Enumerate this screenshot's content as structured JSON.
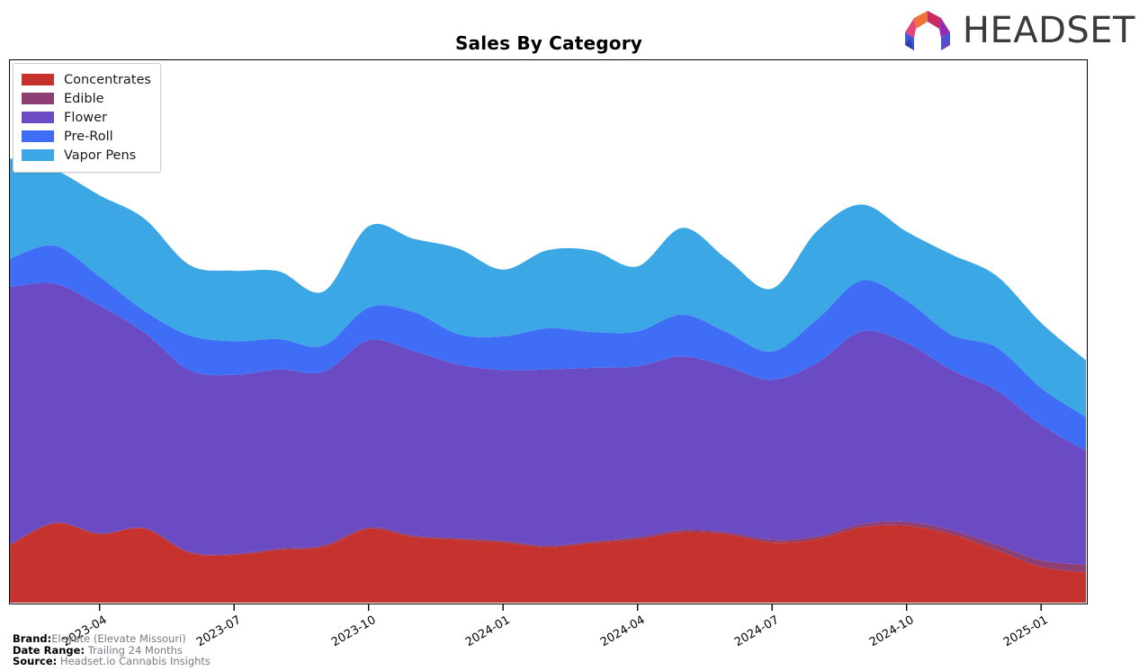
{
  "header": {
    "title": "Sales By Category",
    "logo_text": "HEADSET",
    "logo_icon": "headset-arch-logo"
  },
  "footer": {
    "rows": [
      {
        "key": "Brand:",
        "value": "Elevate (Elevate Missouri)"
      },
      {
        "key": "Date Range:",
        "value": "Trailing 24 Months"
      },
      {
        "key": "Source:",
        "value": "Headset.io Cannabis Insights"
      }
    ]
  },
  "chart_data": {
    "type": "area",
    "stacked": true,
    "title": "Sales By Category",
    "xlabel": "",
    "ylabel": "",
    "grid": false,
    "legend_position": "top-left",
    "x_tick_labels": [
      "2023-04",
      "2023-07",
      "2023-10",
      "2024-01",
      "2024-04",
      "2024-07",
      "2024-10",
      "2025-01"
    ],
    "x_tick_values": [
      3,
      6,
      9,
      12,
      15,
      18,
      21,
      24
    ],
    "x_range": [
      1,
      25
    ],
    "y_range": [
      0,
      100
    ],
    "x": [
      1,
      2,
      3,
      4,
      5,
      6,
      7,
      8,
      9,
      10,
      11,
      12,
      13,
      14,
      15,
      16,
      17,
      18,
      19,
      20,
      21,
      22,
      23,
      24,
      25
    ],
    "colors": {
      "Concentrates": "#c6332f",
      "Edible": "#8e3f73",
      "Flower": "#6b4bc4",
      "Pre-Roll": "#3f6df5",
      "Vapor Pens": "#3ba7e4"
    },
    "series": [
      {
        "name": "Concentrates",
        "color": "#c6332f",
        "values": [
          10.5,
          14.6,
          12.6,
          13.6,
          9.2,
          8.8,
          9.7,
          10.3,
          13.6,
          12.1,
          11.6,
          11.1,
          10.2,
          11.0,
          11.7,
          13.0,
          12.6,
          11.1,
          11.7,
          13.9,
          14.2,
          12.6,
          9.7,
          6.6,
          5.6
        ]
      },
      {
        "name": "Edible",
        "color": "#8e3f73",
        "values": [
          0.2,
          0.2,
          0.2,
          0.2,
          0.2,
          0.2,
          0.3,
          0.3,
          0.3,
          0.3,
          0.3,
          0.3,
          0.3,
          0.3,
          0.4,
          0.4,
          0.4,
          0.5,
          0.5,
          0.6,
          0.7,
          0.8,
          1.0,
          1.2,
          1.4
        ]
      },
      {
        "name": "Flower",
        "color": "#6b4bc4",
        "values": [
          47.5,
          44.0,
          42.0,
          36.0,
          33.5,
          33.0,
          33.0,
          32.0,
          34.5,
          34.0,
          32.0,
          31.5,
          32.5,
          32.0,
          31.5,
          32.0,
          30.5,
          29.5,
          32.0,
          35.5,
          33.0,
          29.5,
          28.5,
          25.0,
          21.0
        ]
      },
      {
        "name": "Pre-Roll",
        "color": "#3f6df5",
        "values": [
          5.2,
          7.0,
          5.3,
          4.0,
          6.4,
          6.2,
          5.6,
          4.8,
          6.0,
          7.2,
          5.6,
          6.2,
          7.6,
          6.6,
          6.4,
          7.7,
          6.3,
          5.2,
          8.0,
          9.4,
          7.8,
          6.5,
          7.9,
          6.8,
          6.2
        ]
      },
      {
        "name": "Vapor Pens",
        "color": "#3ba7e4",
        "values": [
          18.5,
          14.0,
          15.0,
          17.0,
          13.0,
          13.0,
          12.5,
          10.0,
          15.0,
          13.5,
          15.8,
          12.3,
          14.4,
          15.0,
          12.0,
          16.0,
          13.5,
          11.6,
          16.3,
          14.0,
          12.7,
          14.8,
          13.2,
          12.0,
          10.5
        ]
      }
    ]
  },
  "legend": {
    "items": [
      {
        "label": "Concentrates",
        "color": "#c6332f"
      },
      {
        "label": "Edible",
        "color": "#8e3f73"
      },
      {
        "label": "Flower",
        "color": "#6b4bc4"
      },
      {
        "label": "Pre-Roll",
        "color": "#3f6df5"
      },
      {
        "label": "Vapor Pens",
        "color": "#3ba7e4"
      }
    ]
  }
}
